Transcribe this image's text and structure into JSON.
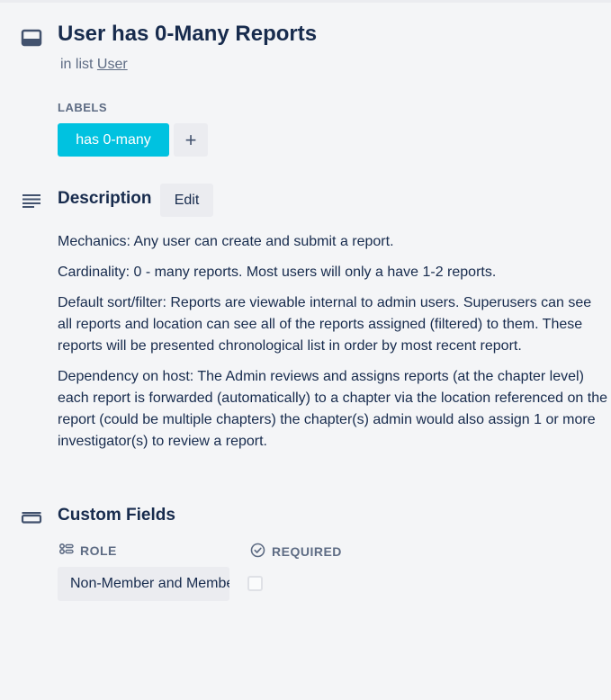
{
  "card": {
    "title": "User has 0-Many Reports",
    "in_list_prefix": "in list",
    "list_name": "User"
  },
  "labels": {
    "heading": "LABELS",
    "items": [
      {
        "text": "has 0-many",
        "color": "#00c2e0"
      }
    ],
    "add_icon": "+"
  },
  "description": {
    "heading": "Description",
    "edit_label": "Edit",
    "paragraphs": [
      "Mechanics: Any user can create and submit a report.",
      "Cardinality: 0 - many reports. Most users will only a have 1-2 reports.",
      "Default sort/filter: Reports are viewable internal to admin users. Superusers can see all reports and location can see all of the reports assigned (filtered) to them. These reports will be presented chronological list in order by most recent report.",
      "Dependency on host: The Admin reviews and assigns reports (at the chapter level) each report is forwarded (automatically) to a chapter via the location referenced on the report (could be multiple chapters) the chapter(s) admin would also assign 1 or more investigator(s) to review a report."
    ]
  },
  "custom_fields": {
    "heading": "Custom Fields",
    "role": {
      "label": "ROLE",
      "value": "Non-Member and Member"
    },
    "required": {
      "label": "REQUIRED",
      "checked": false
    }
  },
  "icons": {
    "card": "card-icon",
    "description": "description-lines-icon",
    "custom_fields": "custom-fields-icon",
    "role": "dropdown-list-icon",
    "required": "check-circle-icon"
  },
  "colors": {
    "background": "#f4f5f7",
    "text": "#172b4d",
    "muted": "#5e6c84",
    "label": "#00c2e0",
    "button": "#ebecf0"
  }
}
